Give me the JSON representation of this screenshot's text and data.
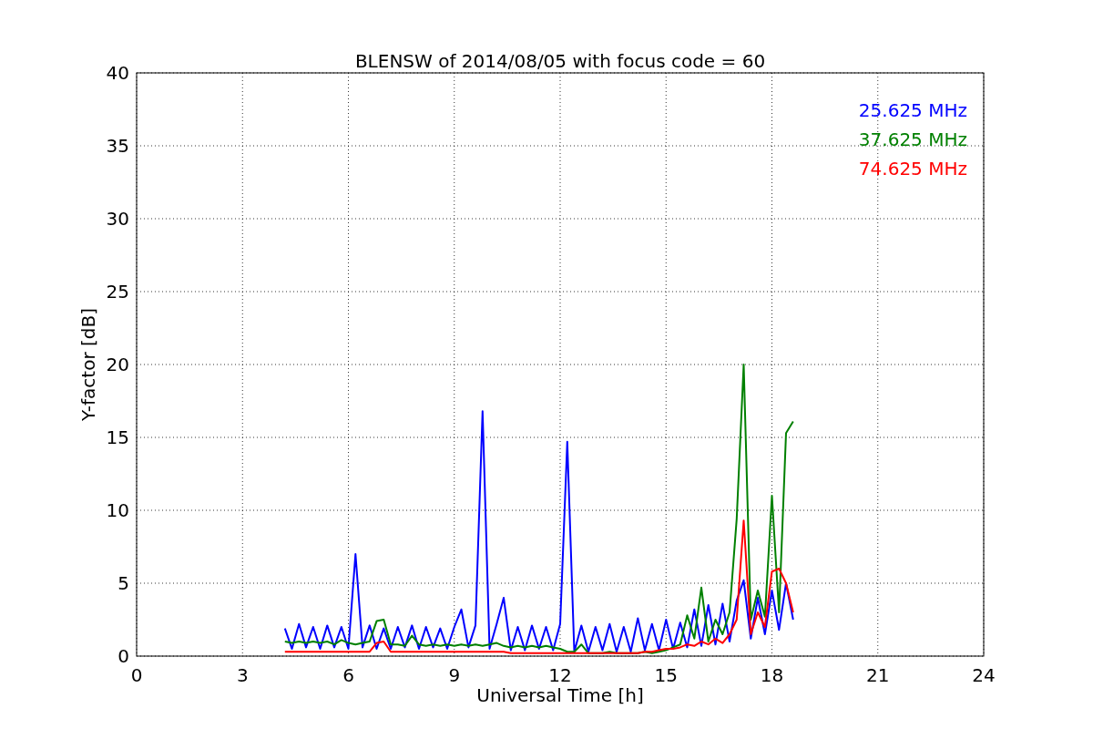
{
  "figure": {
    "chart_data": {
      "type": "line",
      "grid": true,
      "title": "BLENSW of 2014/08/05 with focus code = 60",
      "xlabel": "Universal Time [h]",
      "ylabel": "Y-factor [dB]",
      "xlim": [
        0,
        24
      ],
      "ylim": [
        0,
        40
      ],
      "xticks": [
        0,
        3,
        6,
        9,
        12,
        15,
        18,
        21,
        24
      ],
      "yticks": [
        0,
        5,
        10,
        15,
        20,
        25,
        30,
        35,
        40
      ],
      "x": [
        4.2,
        4.4,
        4.6,
        4.8,
        5.0,
        5.2,
        5.4,
        5.6,
        5.8,
        6.0,
        6.2,
        6.4,
        6.6,
        6.8,
        7.0,
        7.2,
        7.4,
        7.6,
        7.8,
        8.0,
        8.2,
        8.4,
        8.6,
        8.8,
        9.0,
        9.2,
        9.4,
        9.6,
        9.8,
        10.0,
        10.2,
        10.4,
        10.6,
        10.8,
        11.0,
        11.2,
        11.4,
        11.6,
        11.8,
        12.0,
        12.2,
        12.4,
        12.6,
        12.8,
        13.0,
        13.2,
        13.4,
        13.6,
        13.8,
        14.0,
        14.2,
        14.4,
        14.6,
        14.8,
        15.0,
        15.2,
        15.4,
        15.6,
        15.8,
        16.0,
        16.2,
        16.4,
        16.6,
        16.8,
        17.0,
        17.2,
        17.4,
        17.6,
        17.8,
        18.0,
        18.2,
        18.4,
        18.6
      ],
      "series": [
        {
          "name": "25.625 MHz",
          "color": "#0000ff",
          "values": [
            1.9,
            0.5,
            2.2,
            0.6,
            2.0,
            0.5,
            2.1,
            0.6,
            2.0,
            0.5,
            7.0,
            0.6,
            2.1,
            0.5,
            1.9,
            0.5,
            2.0,
            0.6,
            2.1,
            0.5,
            2.0,
            0.6,
            1.9,
            0.5,
            2.0,
            3.2,
            0.6,
            2.1,
            16.8,
            0.5,
            2.2,
            4.0,
            0.4,
            2.0,
            0.4,
            2.1,
            0.5,
            2.0,
            0.4,
            2.2,
            14.7,
            0.3,
            2.1,
            0.3,
            2.0,
            0.4,
            2.2,
            0.3,
            2.0,
            0.3,
            2.6,
            0.4,
            2.2,
            0.4,
            2.5,
            0.5,
            2.3,
            0.6,
            3.2,
            0.7,
            3.5,
            0.8,
            3.6,
            1.0,
            3.8,
            5.2,
            1.2,
            4.0,
            1.5,
            4.5,
            1.8,
            5.0,
            2.5
          ]
        },
        {
          "name": "37.625 MHz",
          "color": "#008000",
          "values": [
            1.0,
            0.9,
            1.0,
            0.9,
            1.0,
            0.9,
            1.0,
            0.8,
            1.1,
            0.9,
            0.8,
            0.9,
            1.0,
            2.4,
            2.5,
            0.8,
            0.8,
            0.7,
            1.4,
            0.8,
            0.7,
            0.8,
            0.7,
            0.8,
            0.7,
            0.8,
            0.7,
            0.8,
            0.7,
            0.8,
            0.9,
            0.7,
            0.6,
            0.7,
            0.6,
            0.7,
            0.6,
            0.7,
            0.6,
            0.5,
            0.3,
            0.3,
            0.8,
            0.2,
            0.2,
            0.2,
            0.3,
            0.2,
            0.2,
            0.2,
            0.2,
            0.3,
            0.2,
            0.3,
            0.4,
            0.6,
            0.8,
            2.8,
            1.2,
            4.7,
            1.0,
            2.5,
            1.5,
            3.0,
            9.4,
            20.0,
            2.5,
            4.5,
            2.7,
            11.0,
            3.0,
            15.3,
            16.1
          ]
        },
        {
          "name": "74.625 MHz",
          "color": "#ff0000",
          "values": [
            0.3,
            0.3,
            0.3,
            0.3,
            0.3,
            0.3,
            0.3,
            0.3,
            0.3,
            0.3,
            0.3,
            0.3,
            0.3,
            0.9,
            1.0,
            0.3,
            0.3,
            0.3,
            0.3,
            0.3,
            0.3,
            0.3,
            0.3,
            0.3,
            0.3,
            0.3,
            0.3,
            0.3,
            0.3,
            0.3,
            0.3,
            0.3,
            0.2,
            0.2,
            0.2,
            0.2,
            0.2,
            0.2,
            0.2,
            0.2,
            0.2,
            0.2,
            0.2,
            0.2,
            0.2,
            0.2,
            0.2,
            0.2,
            0.2,
            0.2,
            0.2,
            0.3,
            0.3,
            0.4,
            0.5,
            0.5,
            0.6,
            0.8,
            0.7,
            1.0,
            0.8,
            1.2,
            0.9,
            1.5,
            2.5,
            9.3,
            1.5,
            3.0,
            2.0,
            5.8,
            6.0,
            5.0,
            3.0
          ]
        }
      ]
    }
  }
}
